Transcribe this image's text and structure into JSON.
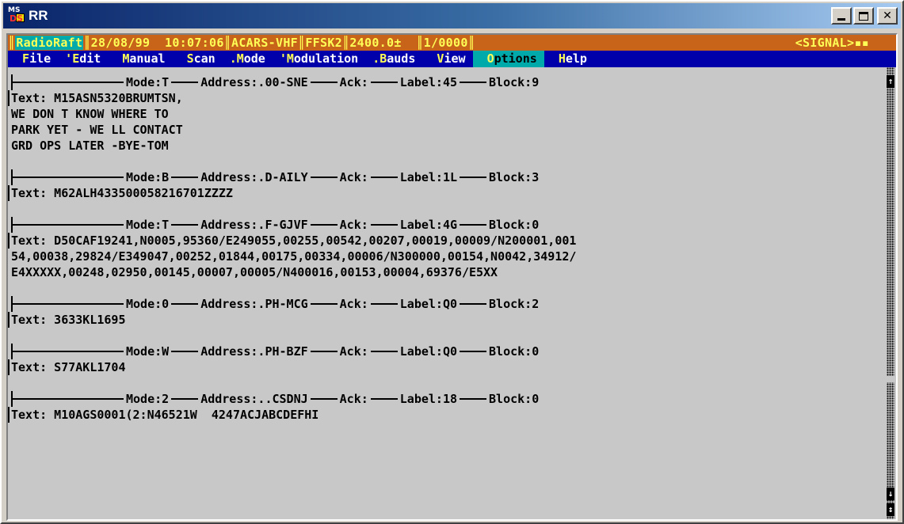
{
  "window": {
    "title": "RR",
    "icon_label_top": "MS",
    "icon_label_bottom": "DS",
    "minimize_icon": "minimize-icon",
    "maximize_icon": "maximize-icon",
    "close_glyph": "✕"
  },
  "status": {
    "app_name": "RadioRaft",
    "date": "28/08/99",
    "time": "10:07:06",
    "mode": "ACARS-VHF",
    "demod": "FFSK2",
    "baud": "2400.0±",
    "counter": "1/0000",
    "signal": "<SIGNAL>▪▪",
    "separator": "║"
  },
  "menu": {
    "items": [
      {
        "hot": "F",
        "rest": "ile",
        "prefix": " "
      },
      {
        "hot": "E",
        "rest": "dit",
        "prefix": "'"
      },
      {
        "hot": "M",
        "rest": "anual",
        "prefix": " "
      },
      {
        "hot": "S",
        "rest": "can",
        "prefix": " "
      },
      {
        "hot": "M",
        "rest": "ode",
        "prefix": "."
      },
      {
        "hot": "M",
        "rest": "odulation",
        "prefix": "'"
      },
      {
        "hot": "B",
        "rest": "auds",
        "prefix": "."
      },
      {
        "hot": "V",
        "rest": "iew",
        "prefix": " "
      },
      {
        "hot": "O",
        "rest": "ptions",
        "prefix": " "
      },
      {
        "hot": "H",
        "rest": "elp",
        "prefix": " "
      }
    ],
    "active_index": 8
  },
  "messages": [
    {
      "mode": "Mode:T",
      "address": "Address:.00-SNE",
      "ack": "Ack:",
      "label": "Label:45",
      "block": "Block:9",
      "lines": [
        "Text: M15ASN5320BRUMTSN,",
        "WE DON T KNOW WHERE TO",
        "PARK YET - WE LL CONTACT",
        "GRD OPS LATER -BYE-TOM"
      ]
    },
    {
      "mode": "Mode:B",
      "address": "Address:.D-AILY",
      "ack": "Ack:",
      "label": "Label:1L",
      "block": "Block:3",
      "lines": [
        "Text: M62ALH433500058216701ZZZZ"
      ]
    },
    {
      "mode": "Mode:T",
      "address": "Address:.F-GJVF",
      "ack": "Ack:",
      "label": "Label:4G",
      "block": "Block:0",
      "lines": [
        "Text: D50CAF19241,N0005,95360/E249055,00255,00542,00207,00019,00009/N200001,001",
        "54,00038,29824/E349047,00252,01844,00175,00334,00006/N300000,00154,N0042,34912/",
        "E4XXXXX,00248,02950,00145,00007,00005/N400016,00153,00004,69376/E5XX"
      ]
    },
    {
      "mode": "Mode:0",
      "address": "Address:.PH-MCG",
      "ack": "Ack:",
      "label": "Label:Q0",
      "block": "Block:2",
      "lines": [
        "Text: 3633KL1695"
      ]
    },
    {
      "mode": "Mode:W",
      "address": "Address:.PH-BZF",
      "ack": "Ack:",
      "label": "Label:Q0",
      "block": "Block:0",
      "lines": [
        "Text: S77AKL1704"
      ]
    },
    {
      "mode": "Mode:2",
      "address": "Address:..CSDNJ",
      "ack": "Ack:",
      "label": "Label:18",
      "block": "Block:0",
      "lines": [
        "Text: M10AGS0001(2:N46521W  4247ACJABCDEFHI"
      ]
    }
  ],
  "scrollbar": {
    "up_arrow": "↑",
    "down_arrow": "↓",
    "both_arrow": "↕"
  }
}
